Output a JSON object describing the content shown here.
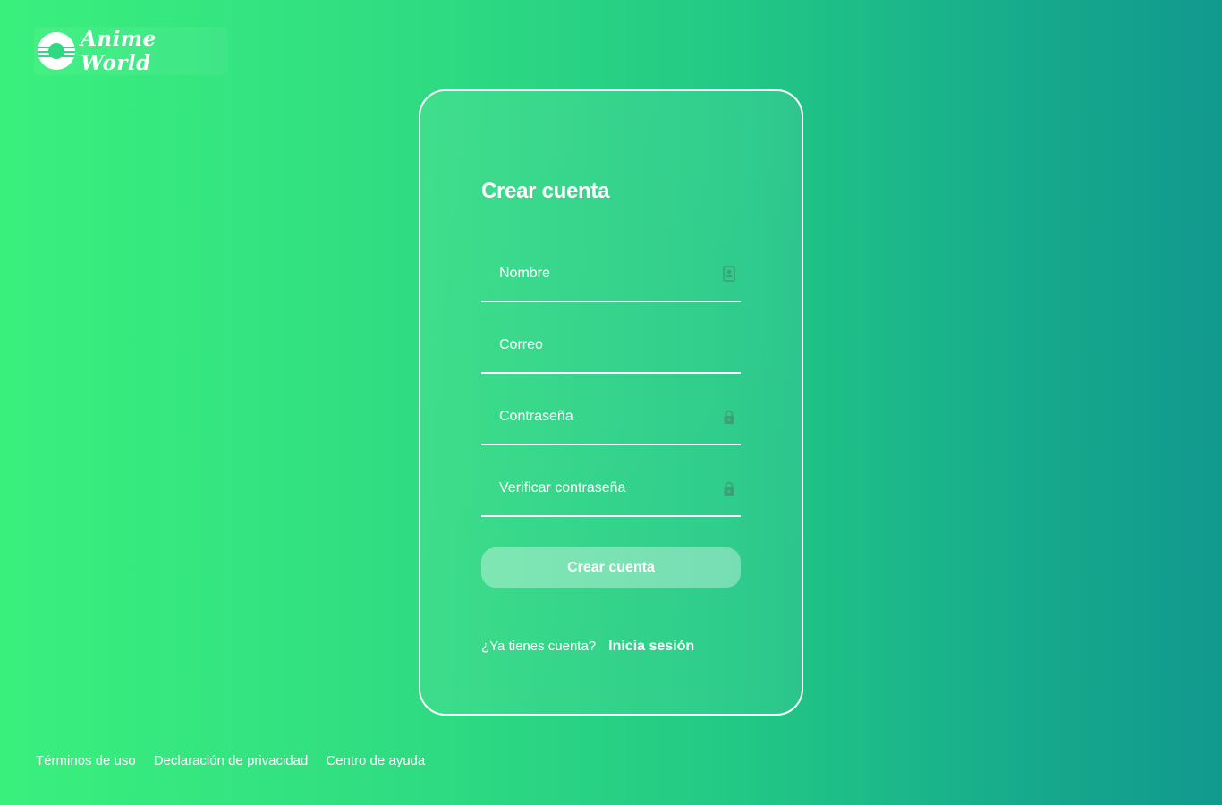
{
  "brand": {
    "name": "Anime World"
  },
  "form": {
    "title": "Crear cuenta",
    "fields": [
      {
        "label": "Nombre",
        "icon": "contact-card-icon"
      },
      {
        "label": "Correo",
        "icon": ""
      },
      {
        "label": "Contraseña",
        "icon": "lock-icon"
      },
      {
        "label": "Verificar contraseña",
        "icon": "lock-icon"
      }
    ],
    "submit_label": "Crear cuenta",
    "login_prompt": "¿Ya tienes cuenta?",
    "login_link": "Inicia sesión"
  },
  "footer": {
    "links": [
      "Términos de uso",
      "Declaración de privacidad",
      "Centro de ayuda"
    ]
  },
  "colors": {
    "gradient_start": "#3af07d",
    "gradient_end": "#11998e",
    "text": "#ffffff"
  }
}
